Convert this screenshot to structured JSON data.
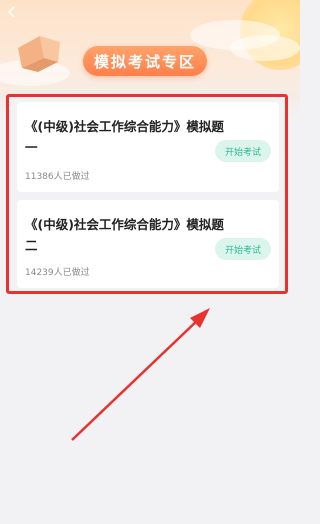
{
  "header": {
    "title": "模拟考试专区"
  },
  "exams": [
    {
      "title": "《(中级)社会工作综合能力》模拟题一",
      "count": "11386人已做过",
      "button": "开始考试"
    },
    {
      "title": "《(中级)社会工作综合能力》模拟题二",
      "count": "14239人已做过",
      "button": "开始考试"
    }
  ],
  "colors": {
    "accent": "#ff8a55",
    "highlight": "#e8322f",
    "button_bg": "#dcf5ec",
    "button_text": "#2fb894"
  },
  "icons": {
    "back": "back-arrow-icon"
  }
}
